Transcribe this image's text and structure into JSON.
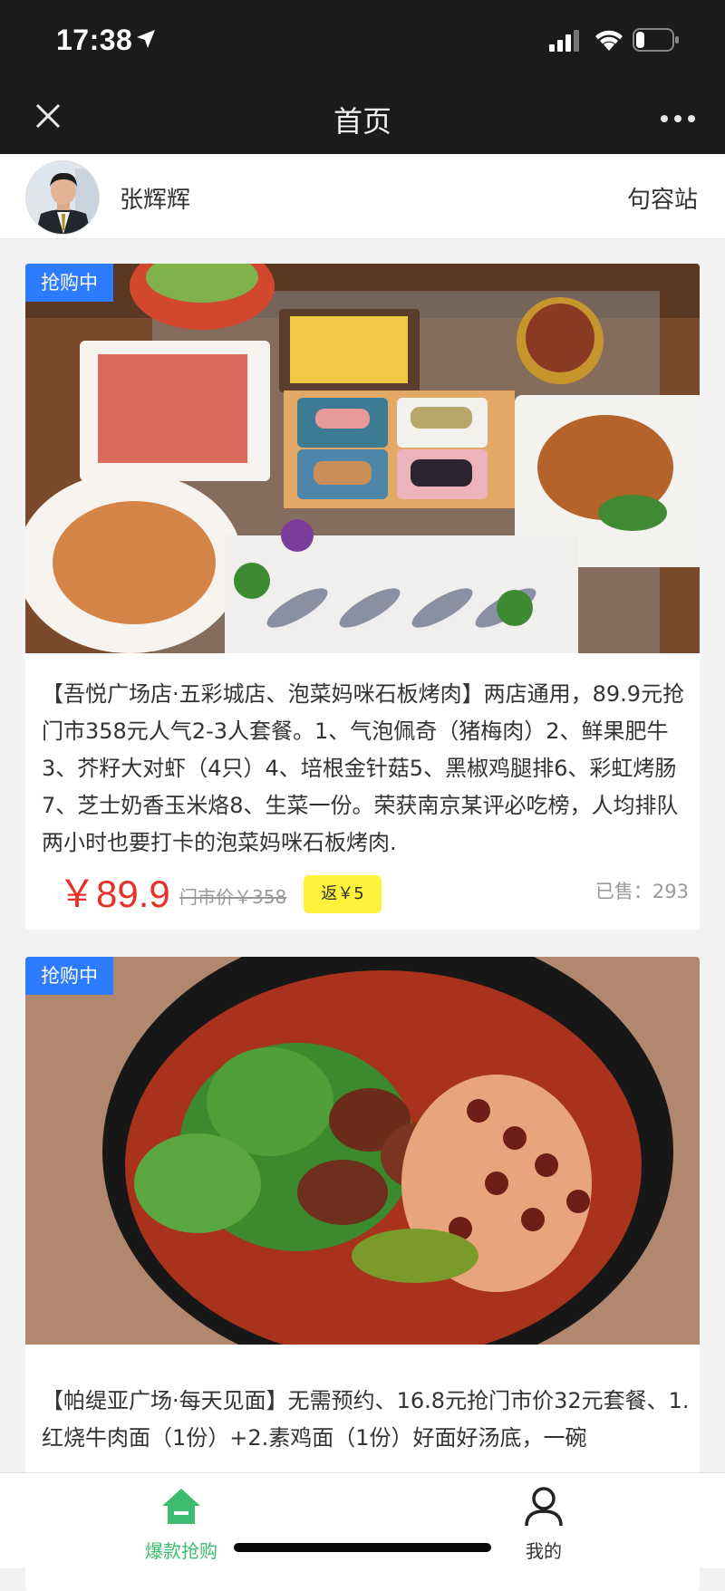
{
  "status_bar": {
    "time": "17:38"
  },
  "nav": {
    "title": "首页"
  },
  "user": {
    "name": "张辉辉",
    "station": "句容站"
  },
  "products": [
    {
      "badge": "抢购中",
      "description": "【吾悦广场店·五彩城店、泡菜妈咪石板烤肉】两店通用，89.9元抢门市358元人气2-3人套餐。1、气泡佩奇（猪梅肉）2、鲜果肥牛3、芥籽大对虾（4只）4、培根金针菇5、黑椒鸡腿排6、彩虹烤肠7、芝士奶香玉米烙8、生菜一份。荣获南京某评必吃榜，人均排队两小时也要打卡的泡菜妈咪石板烤肉.",
      "price": "￥89.9",
      "original_price": "门市价￥358",
      "rebate": "返￥5",
      "sold": "已售：293"
    },
    {
      "badge": "抢购中",
      "description": "【帕缇亚广场·每天见面】无需预约、16.8元抢门市价32元套餐、1.红烧牛肉面（1份）+2.素鸡面（1份）好面好汤底，一碗"
    }
  ],
  "tabbar": {
    "tab1_label": "爆款抢购",
    "tab2_label": "我的",
    "active_color": "#3dbb6e"
  },
  "colors": {
    "accent_blue": "#2d7bff",
    "price_red": "#e8312b",
    "rebate_yellow": "#fff23a"
  }
}
